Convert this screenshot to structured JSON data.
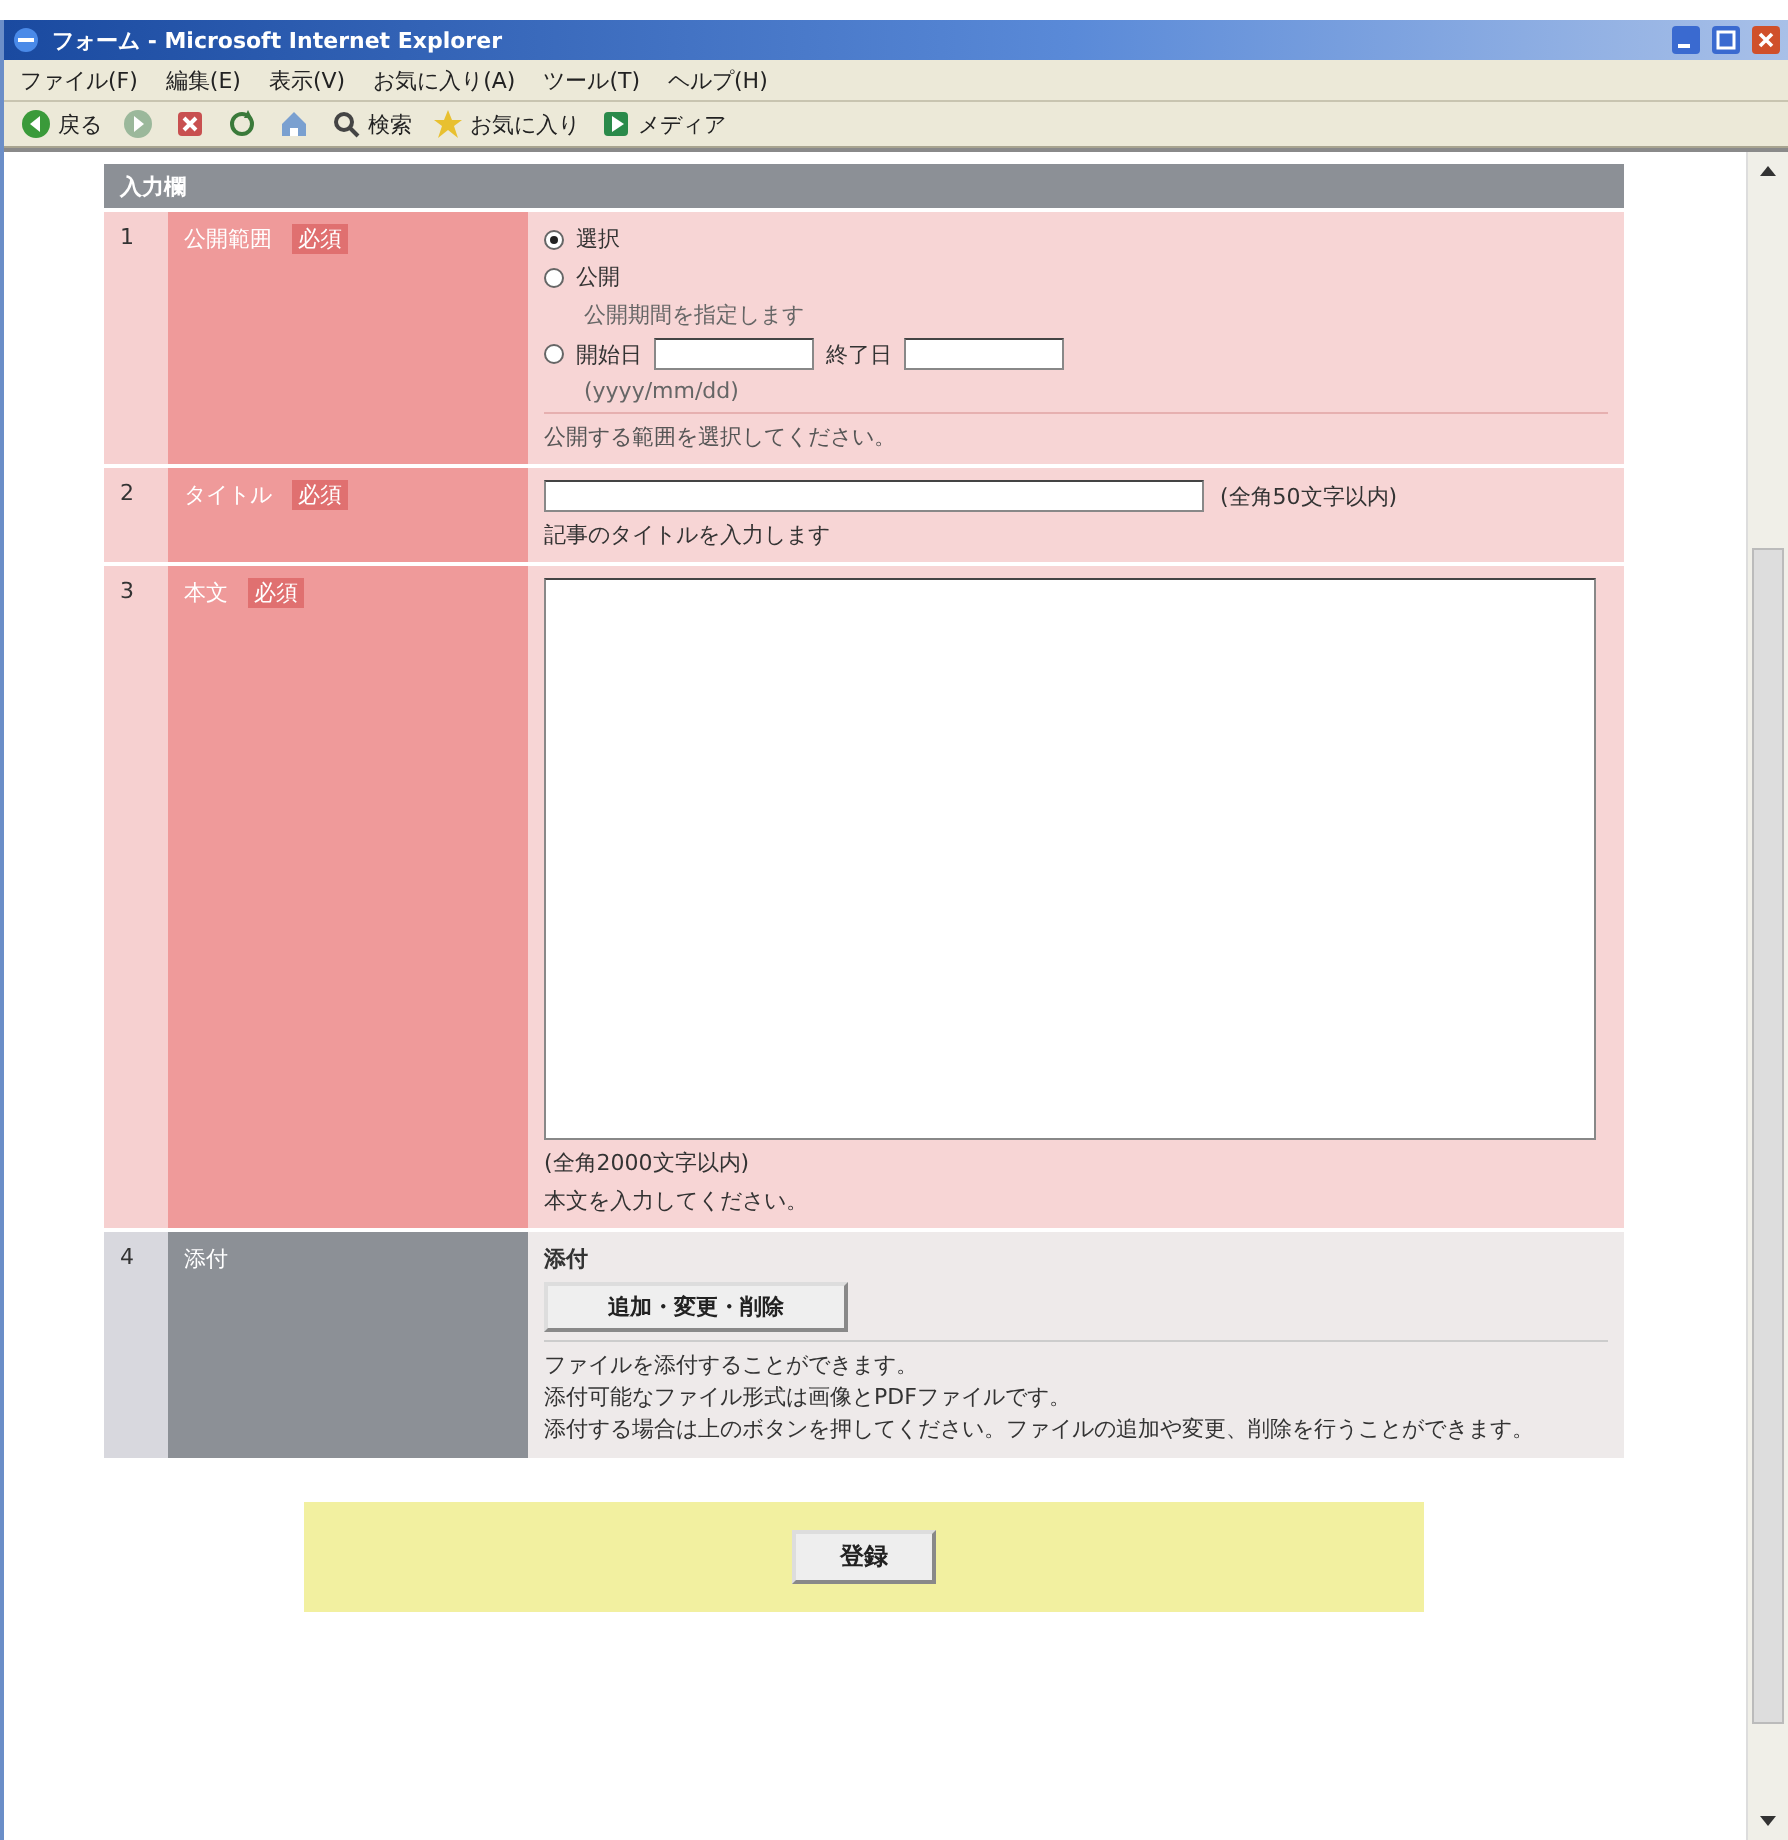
{
  "window": {
    "title": "フォーム - Microsoft Internet Explorer"
  },
  "menu": [
    "ファイル(F)",
    "編集(E)",
    "表示(V)",
    "お気に入り(A)",
    "ツール(T)",
    "ヘルプ(H)"
  ],
  "toolbar": [
    {
      "label": "戻る",
      "kind": "back"
    },
    {
      "kind": "forward"
    },
    {
      "kind": "stop"
    },
    {
      "kind": "refresh"
    },
    {
      "kind": "home"
    },
    {
      "label": "検索",
      "kind": "search"
    },
    {
      "label": "お気に入り",
      "kind": "star"
    },
    {
      "label": "メディア",
      "kind": "media"
    }
  ],
  "form": {
    "header": "入力欄",
    "rows": [
      {
        "number": "1",
        "label": "公開範囲",
        "badge": "必須",
        "required": true,
        "kind": "radio",
        "options": [
          {
            "kind": "plain",
            "label": "選択",
            "selected": true
          },
          {
            "kind": "plain",
            "label": "公開",
            "selected": false,
            "note": "公開期間を指定します"
          },
          {
            "kind": "dates",
            "label": "開始日",
            "label2": "終了日",
            "selected": false,
            "note": "(yyyy/mm/dd)"
          }
        ],
        "hint": "公開する範囲を選択してください。"
      },
      {
        "number": "2",
        "label": "タイトル",
        "badge": "必須",
        "required": true,
        "kind": "text",
        "limit": "(全角50文字以内)",
        "hint": "記事のタイトルを入力します"
      },
      {
        "number": "3",
        "label": "本文",
        "badge": "必須",
        "required": true,
        "kind": "textarea",
        "limit": "(全角2000文字以内)",
        "hint": "本文を入力してください。"
      },
      {
        "number": "4",
        "label": "添付",
        "required": false,
        "kind": "attach",
        "caption": "添付",
        "button": "追加・変更・削除",
        "lines": [
          "ファイルを添付することができます。",
          "添付可能なファイル形式は画像とPDFファイルです。",
          "添付する場合は上のボタンを押してください。ファイルの追加や変更、削除を行うことができます。"
        ]
      }
    ]
  },
  "submit": {
    "button": "登録"
  }
}
